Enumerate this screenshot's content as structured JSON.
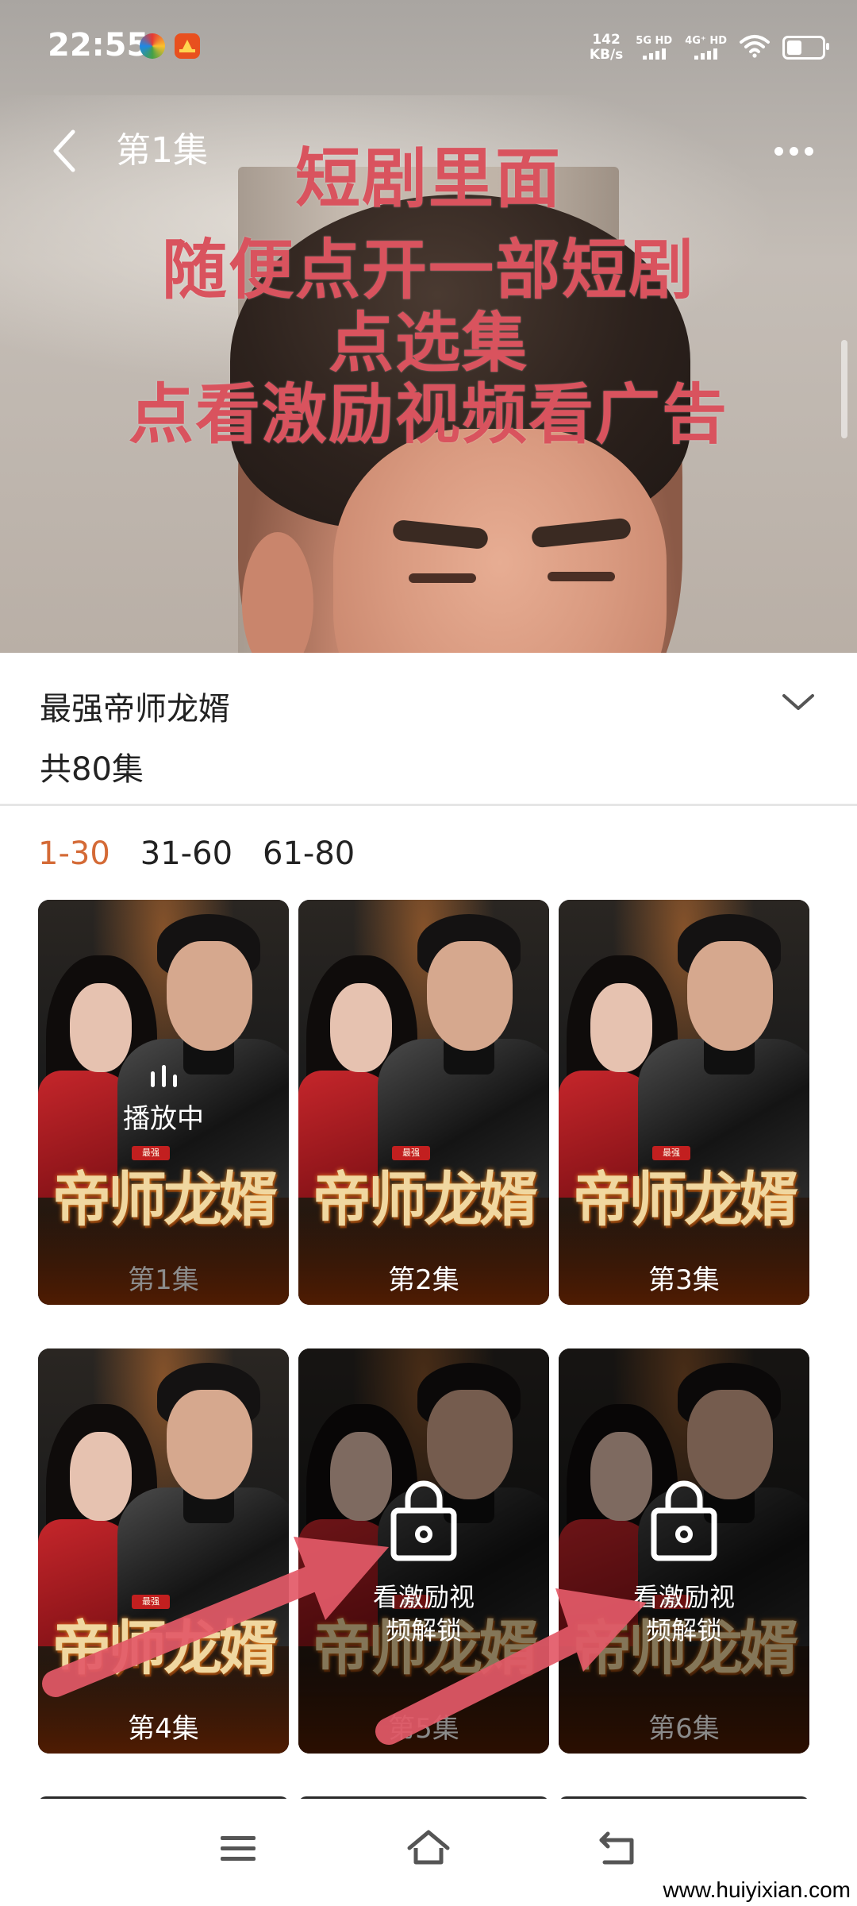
{
  "status_bar": {
    "time": "22:55",
    "net_speed_value": "142",
    "net_speed_unit": "KB/s",
    "sim1_label": "5G HD",
    "sim2_label": "4G⁺ HD"
  },
  "top_bar": {
    "episode_title": "第1集",
    "back_icon": "chevron-left-icon",
    "more_icon": "more-dots-icon"
  },
  "overlay_text": [
    "短剧里面",
    "随便点开一部短剧",
    "点选集",
    "点看激励视频看广告"
  ],
  "drama": {
    "title": "最强帝师龙婿",
    "episode_count": "共80集"
  },
  "range_tabs": [
    {
      "label": "1-30",
      "active": true
    },
    {
      "label": "31-60",
      "active": false
    },
    {
      "label": "61-80",
      "active": false
    }
  ],
  "poster_logo": "帝师龙婿",
  "poster_badge": "最强",
  "episodes": [
    {
      "label": "第1集",
      "state": "playing",
      "status_text": "播放中"
    },
    {
      "label": "第2集",
      "state": "free"
    },
    {
      "label": "第3集",
      "state": "free"
    },
    {
      "label": "第4集",
      "state": "free"
    },
    {
      "label": "第5集",
      "state": "locked",
      "unlock_line1": "看激励视",
      "unlock_line2": "频解锁"
    },
    {
      "label": "第6集",
      "state": "locked",
      "unlock_line1": "看激励视",
      "unlock_line2": "频解锁"
    }
  ],
  "colors": {
    "overlay_text": "#d9535e",
    "active_tab": "#d46a36",
    "arrow": "#e35a68"
  },
  "nav": {
    "menu_icon": "menu-icon",
    "home_icon": "home-icon",
    "back_icon": "back-icon"
  },
  "watermark": "www.huiyixian.com"
}
